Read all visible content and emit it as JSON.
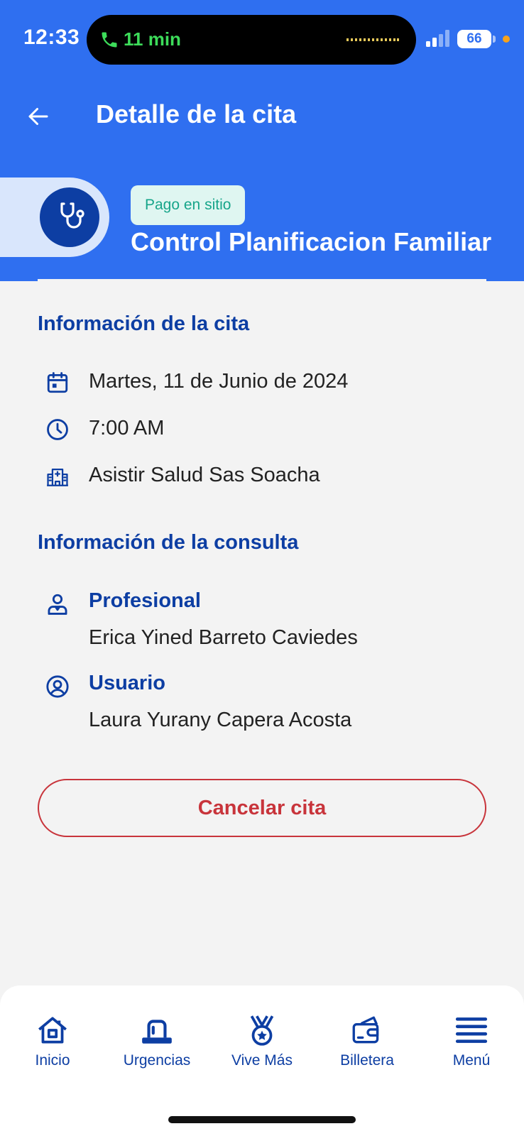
{
  "status_bar": {
    "time": "12:33",
    "call_duration": "11 min",
    "battery": "66"
  },
  "header": {
    "title": "Detalle de la cita",
    "payment_badge": "Pago en sitio",
    "service_name": "Control Planificacion Familiar"
  },
  "appointment_info": {
    "heading": "Información de la cita",
    "date": "Martes, 11 de Junio de 2024",
    "time": "7:00 AM",
    "location": "Asistir Salud Sas Soacha"
  },
  "consultation_info": {
    "heading": "Información de la consulta",
    "professional_label": "Profesional",
    "professional_name": "Erica Yined Barreto Caviedes",
    "user_label": "Usuario",
    "user_name": "Laura Yurany Capera Acosta"
  },
  "actions": {
    "cancel_label": "Cancelar cita"
  },
  "bottom_nav": {
    "items": [
      {
        "label": "Inicio",
        "icon": "home-icon"
      },
      {
        "label": "Urgencias",
        "icon": "siren-icon"
      },
      {
        "label": "Vive Más",
        "icon": "medal-icon"
      },
      {
        "label": "Billetera",
        "icon": "wallet-icon"
      },
      {
        "label": "Menú",
        "icon": "menu-icon"
      }
    ]
  },
  "colors": {
    "primary": "#2f6ff0",
    "dark_blue": "#0d3ea3",
    "danger": "#c8343b",
    "badge_bg": "#dff6f1",
    "badge_text": "#17a58a",
    "background": "#f3f3f3"
  }
}
